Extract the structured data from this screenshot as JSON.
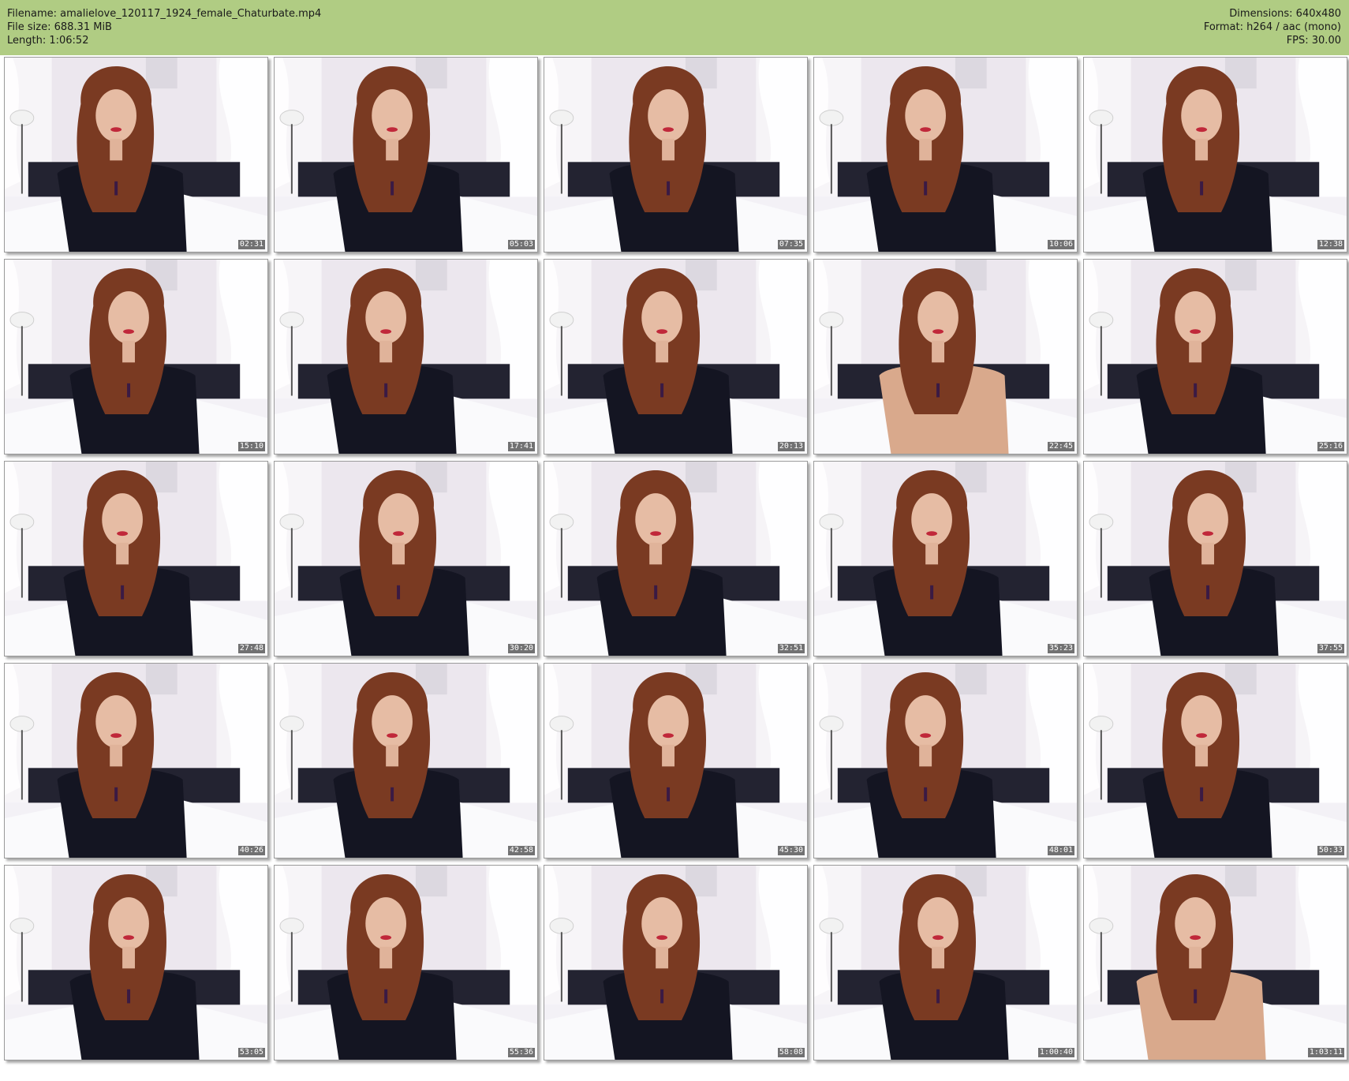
{
  "header": {
    "filename_label": "Filename: amalielove_120117_1924_female_Chaturbate.mp4",
    "filesize_label": "File size: 688.31 MiB",
    "length_label": "Length: 1:06:52",
    "dimensions_label": "Dimensions: 640x480",
    "format_label": "Format: h264 / aac (mono)",
    "fps_label": "FPS: 30.00",
    "background_color": "#b0cc83"
  },
  "thumbnails": [
    {
      "timestamp": "02:31"
    },
    {
      "timestamp": "05:03"
    },
    {
      "timestamp": "07:35"
    },
    {
      "timestamp": "10:06"
    },
    {
      "timestamp": "12:38"
    },
    {
      "timestamp": "15:10"
    },
    {
      "timestamp": "17:41"
    },
    {
      "timestamp": "20:13"
    },
    {
      "timestamp": "22:45"
    },
    {
      "timestamp": "25:16"
    },
    {
      "timestamp": "27:48"
    },
    {
      "timestamp": "30:20"
    },
    {
      "timestamp": "32:51"
    },
    {
      "timestamp": "35:23"
    },
    {
      "timestamp": "37:55"
    },
    {
      "timestamp": "40:26"
    },
    {
      "timestamp": "42:58"
    },
    {
      "timestamp": "45:30"
    },
    {
      "timestamp": "48:01"
    },
    {
      "timestamp": "50:33"
    },
    {
      "timestamp": "53:05"
    },
    {
      "timestamp": "55:36"
    },
    {
      "timestamp": "58:08"
    },
    {
      "timestamp": "1:00:40"
    },
    {
      "timestamp": "1:03:11"
    }
  ]
}
